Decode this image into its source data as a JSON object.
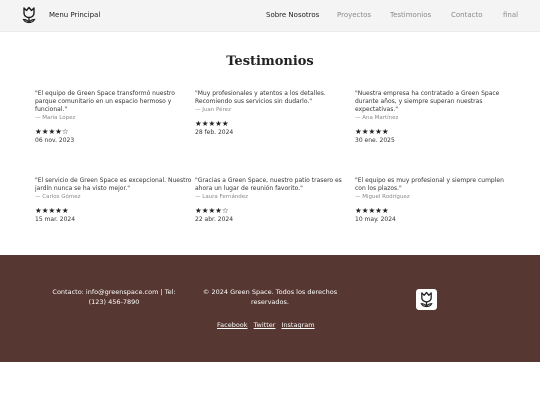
{
  "header": {
    "brand": "Menu Principal",
    "nav": [
      "Sobre Nosotros",
      "Proyectos",
      "Testimonios",
      "Contacto",
      "final"
    ]
  },
  "main": {
    "title": "Testimonios",
    "testimonials": [
      {
        "quote": "\"El equipo de Green Space transformó nuestro parque comunitario en un espacio hermoso y funcional.\"",
        "author": "— María López",
        "stars": "★★★★☆",
        "rating": 4,
        "date": "06 nov. 2023"
      },
      {
        "quote": "\"Muy profesionales y atentos a los detalles. Recomiendo sus servicios sin dudarlo.\"",
        "author": "— Juan Pérez",
        "stars": "★★★★★",
        "rating": 5,
        "date": "28 feb. 2024"
      },
      {
        "quote": "\"Nuestra empresa ha contratado a Green Space durante años, y siempre superan nuestras expectativas.\"",
        "author": "— Ana Martínez",
        "stars": "★★★★★",
        "rating": 5,
        "date": "30 ene. 2025"
      },
      {
        "quote": "\"El servicio de Green Space es excepcional. Nuestro jardín nunca se ha visto mejor.\"",
        "author": "— Carlos Gómez",
        "stars": "★★★★★",
        "rating": 5,
        "date": "15 mar. 2024"
      },
      {
        "quote": "\"Gracias a Green Space, nuestro patio trasero es ahora un lugar de reunión favorito.\"",
        "author": "— Laura Fernández",
        "stars": "★★★★☆",
        "rating": 4,
        "date": "22 abr. 2024"
      },
      {
        "quote": "\"El equipo es muy profesional y siempre cumplen con los plazos.\"",
        "author": "— Miguel Rodríguez",
        "stars": "★★★★★",
        "rating": 5,
        "date": "10 may. 2024"
      }
    ]
  },
  "footer": {
    "contact": "Contacto: info@greenspace.com | Tel: (123) 456-7890",
    "copyright": "© 2024 Green Space. Todos los derechos reservados.",
    "links": [
      "Facebook",
      "Twitter",
      "Instagram"
    ]
  },
  "icons": {
    "logo": "tulip-icon",
    "footer_logo": "tulip-icon"
  },
  "colors": {
    "footer_bg": "#563731",
    "topbar_bg": "#f4f4f4"
  }
}
